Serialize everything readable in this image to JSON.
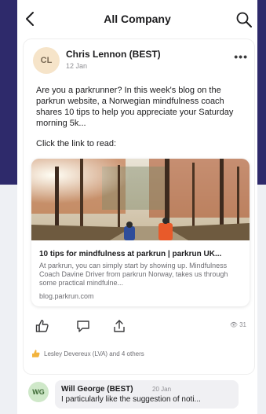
{
  "header": {
    "title": "All Company",
    "back_icon": "chevron-left-icon",
    "search_icon": "search-icon"
  },
  "post": {
    "avatar_initials": "CL",
    "author": "Chris Lennon (BEST)",
    "date": "12 Jan",
    "more_icon": "more-horizontal-icon",
    "body": "Are you a parkrunner? In this week's blog on the parkrun website, a Norwegian mindfulness coach shares 10 tips to help you appreciate your Saturday morning 5k...",
    "click_text": "Click the link to read:",
    "link": {
      "title": "10 tips for mindfulness at parkrun | parkrun UK...",
      "description": "At parkrun, you can simply start by showing up. Mindfulness Coach Davine Driver from parkrun Norway, takes us through some practical mindfulne...",
      "domain": "blog.parkrun.com"
    },
    "actions": {
      "like_icon": "thumbs-up-icon",
      "comment_icon": "comment-icon",
      "share_icon": "share-icon",
      "views_icon": "eye-icon",
      "views": "31"
    },
    "reactions_text": "Lesley Devereux (LVA) and 4 others"
  },
  "comment": {
    "avatar_initials": "WG",
    "author": "Will George (BEST)",
    "date": "20 Jan",
    "text": "I particularly like the suggestion of noti..."
  },
  "colors": {
    "navy_background": "#2e2a6b",
    "like_reaction": "#f2b33d"
  }
}
